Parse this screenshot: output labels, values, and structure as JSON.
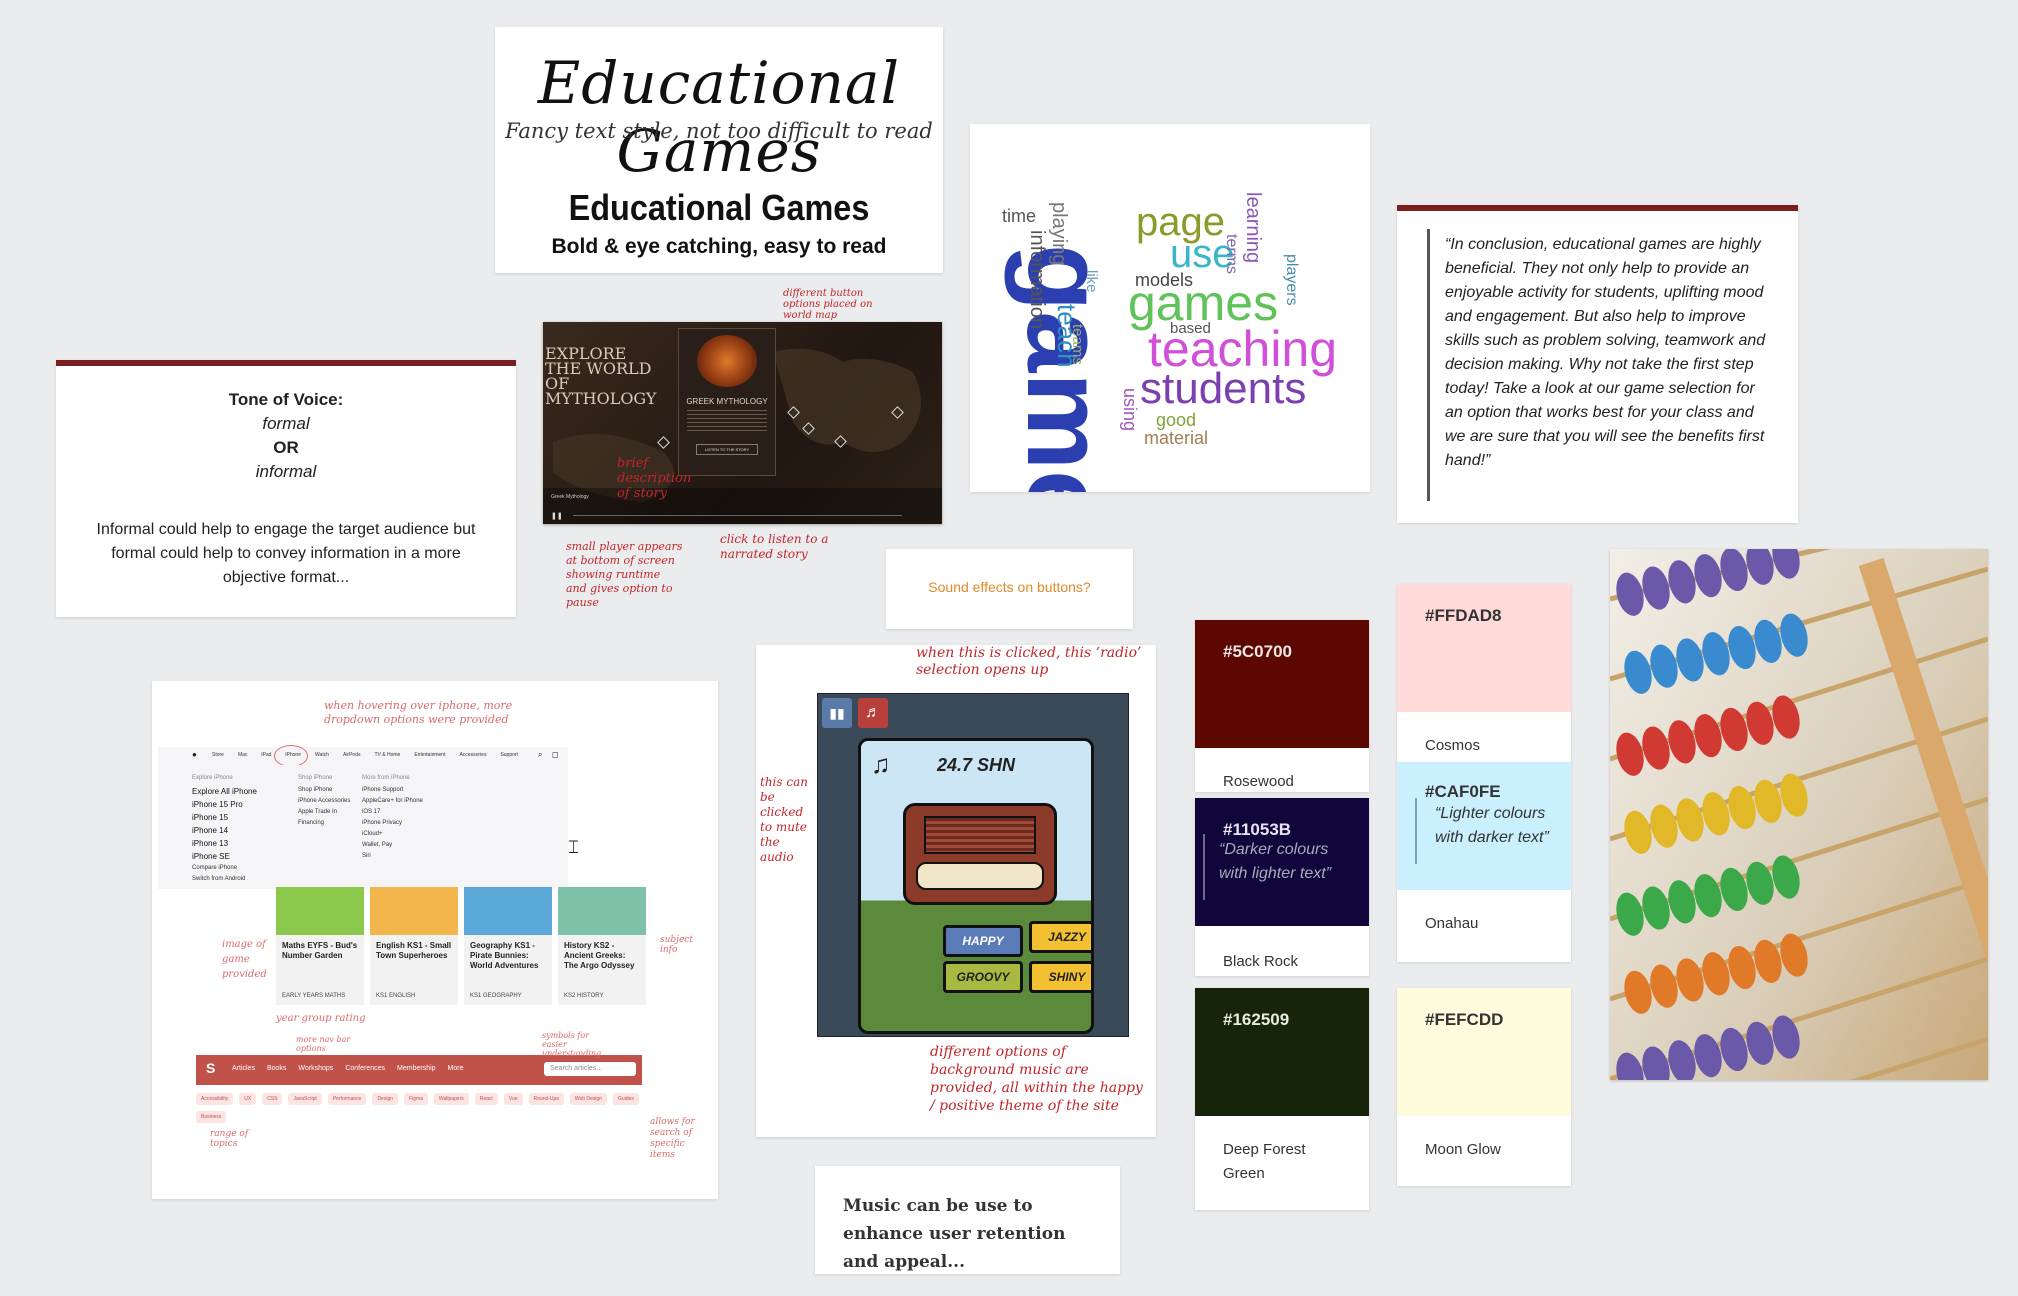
{
  "font_card": {
    "script_title": "Educational Games",
    "script_caption": "Fancy text style, not too difficult to read",
    "bold_title": "Educational Games",
    "bold_caption": "Bold & eye catching, easy to read"
  },
  "tone_card": {
    "title": "Tone of Voice:",
    "opt1": "formal",
    "or": "OR",
    "opt2": "informal",
    "body": "Informal could help to engage the target audience but formal could help to convey information in a more objective format..."
  },
  "myth_card": {
    "headline": "EXPLORE THE WORLD OF MYTHOLOGY",
    "panel_title": "GREEK MYTHOLOGY",
    "listen": "LISTEN TO THE STORY",
    "player_label": "Greek Mythology",
    "notes": {
      "buttons": "different button options placed on world map",
      "desc": "brief description of story",
      "player": "small player appears at bottom of screen showing runtime and gives option to pause",
      "listen": "click to listen to a narrated story"
    }
  },
  "wordcloud": {
    "words": [
      {
        "t": "game",
        "c": "#2b3fb0"
      },
      {
        "t": "games",
        "c": "#5fc35a"
      },
      {
        "t": "teaching",
        "c": "#d050d8"
      },
      {
        "t": "students",
        "c": "#7b3fb0"
      },
      {
        "t": "page",
        "c": "#8b9a2a"
      },
      {
        "t": "use",
        "c": "#39b6c8"
      },
      {
        "t": "teach",
        "c": "#2f8fbf"
      },
      {
        "t": "learning",
        "c": "#8d57b3"
      },
      {
        "t": "information",
        "c": "#555"
      },
      {
        "t": "playing",
        "c": "#777"
      },
      {
        "t": "models",
        "c": "#444"
      },
      {
        "t": "time",
        "c": "#555"
      },
      {
        "t": "good",
        "c": "#7da53a"
      },
      {
        "t": "material",
        "c": "#a08050"
      },
      {
        "t": "using",
        "c": "#a155c0"
      },
      {
        "t": "players",
        "c": "#4a8bb0"
      },
      {
        "t": "terms",
        "c": "#8066aa"
      },
      {
        "t": "based",
        "c": "#555"
      },
      {
        "t": "like",
        "c": "#6aa0c0"
      },
      {
        "t": "teams",
        "c": "#9bb06a"
      }
    ]
  },
  "quote_card": {
    "text": "“In conclusion, educational games are highly beneficial. They not only help to provide an enjoyable activity for students, uplifting mood and engagement. But also help to improve skills such as problem solving, teamwork and decision making. Why not take the first step today! Take a look at our game selection for an option that works best for your class and we are sure that you will see the benefits first hand!”"
  },
  "sound_card": {
    "text": "Sound effects on buttons?"
  },
  "radio_card": {
    "station": "24.7 SHN",
    "buttons": [
      "HAPPY",
      "JAZZY",
      "GROOVY",
      "SHINY"
    ],
    "notes": {
      "top": "when this is clicked, this ‘radio’ selection opens up",
      "left": "this can be clicked to mute the audio",
      "bottom": "different options of background music are provided, all within the happy / positive theme of the site"
    }
  },
  "music_card": {
    "text": "Music can be use to enhance user retention and appeal..."
  },
  "swatches": [
    {
      "hex": "#5C0700",
      "name": "Rosewood",
      "color": "#5c0700"
    },
    {
      "hex": "#11053B",
      "name": "Black Rock",
      "color": "#11053b",
      "quote": "“Darker colours with lighter text”"
    },
    {
      "hex": "#162509",
      "name": "Deep Forest Green",
      "color": "#162509"
    },
    {
      "hex": "#FFDAD8",
      "name": "Cosmos",
      "color": "#ffdad8"
    },
    {
      "hex": "#CAF0FE",
      "name": "Onahau",
      "color": "#caf0fe",
      "quote": "“Lighter colours with darker text”"
    },
    {
      "hex": "#FEFCDD",
      "name": "Moon Glow",
      "color": "#fefcdd"
    }
  ],
  "shop_card": {
    "nav": [
      "Store",
      "Mac",
      "iPad",
      "iPhone",
      "Watch",
      "AirPods",
      "TV & Home",
      "Entertainment",
      "Accessories",
      "Support"
    ],
    "menu_col1_head": "Explore iPhone",
    "menu_col1": [
      "Explore All iPhone",
      "iPhone 15 Pro",
      "iPhone 15",
      "iPhone 14",
      "iPhone 13",
      "iPhone SE"
    ],
    "menu_col1_extra": [
      "Compare iPhone",
      "Switch from Android"
    ],
    "menu_col2_head": "Shop iPhone",
    "menu_col2": [
      "Shop iPhone",
      "iPhone Accessories",
      "Apple Trade In",
      "Financing"
    ],
    "menu_col3_head": "More from iPhone",
    "menu_col3": [
      "iPhone Support",
      "AppleCare+ for iPhone",
      "iOS 17",
      "iPhone Privacy",
      "iCloud+",
      "Wallet, Pay",
      "Siri"
    ],
    "games": [
      {
        "title": "Maths EYFS - Bud's Number Garden",
        "tag": "EARLY YEARS MATHS",
        "color": "#8cc84b"
      },
      {
        "title": "English KS1 - Small Town Superheroes",
        "tag": "KS1 ENGLISH",
        "color": "#f2b64c"
      },
      {
        "title": "Geography KS1 - Pirate Bunnies: World Adventures",
        "tag": "KS1 GEOGRAPHY",
        "color": "#5aa7d8"
      },
      {
        "title": "History KS2 - Ancient Greeks: The Argo Odyssey",
        "tag": "KS2 HISTORY",
        "color": "#7ec0a8"
      }
    ],
    "bar_items": [
      "Articles",
      "Books",
      "Workshops",
      "Conferences",
      "Membership",
      "More"
    ],
    "search_placeholder": "Search articles...",
    "tags": [
      "Accessibility",
      "UX",
      "CSS",
      "JavaScript",
      "Performance",
      "Design",
      "Figma",
      "Wallpapers",
      "React",
      "Vue",
      "Round-Ups",
      "Web Design",
      "Guides",
      "Business"
    ],
    "notes": {
      "hover": "when hovering over iphone, more dropdown options were provided",
      "image": "image of game provided",
      "age": "year group rating",
      "subject": "subject info",
      "more": "more nav bar options",
      "symbols": "symbols for easier understanding",
      "topics": "range of topics",
      "search": "allows for search of specific items"
    }
  }
}
